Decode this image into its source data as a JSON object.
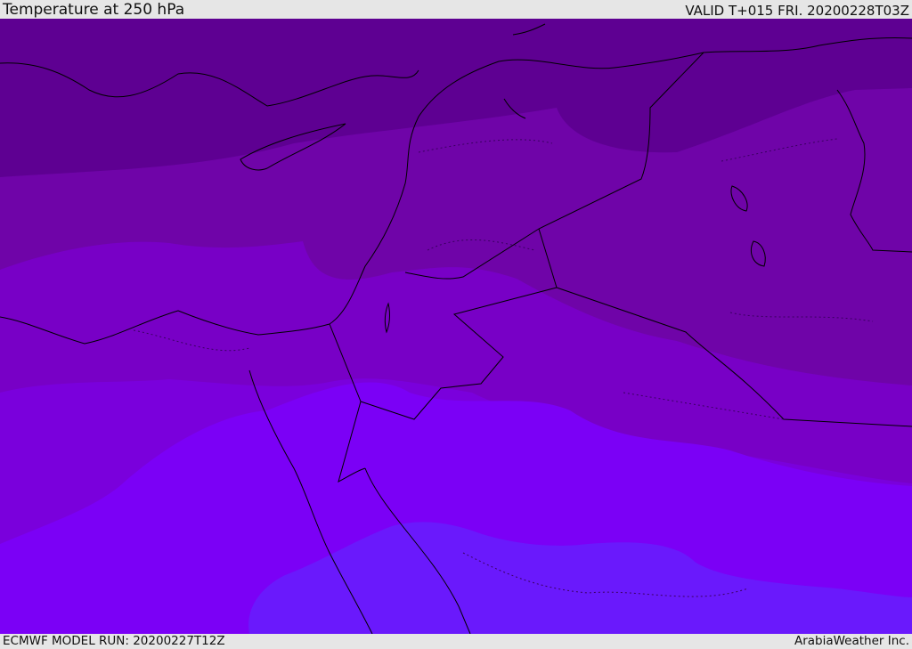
{
  "header": {
    "title": "Temperature at 250 hPa",
    "valid": "VALID T+015 FRI. 20200228T03Z"
  },
  "footer": {
    "model_run": "ECMWF MODEL RUN: 20200227T12Z",
    "brand": "ArabiaWeather Inc."
  },
  "map": {
    "variable": "temperature",
    "level": "250 hPa",
    "colors": {
      "band_coldest": "#5e0092",
      "band_2": "#6f04a8",
      "band_3": "#7800c6",
      "band_4": "#7a00dc",
      "band_5": "#7b00f6",
      "band_warmest": "#6a19fc",
      "coastline": "#000000"
    }
  }
}
